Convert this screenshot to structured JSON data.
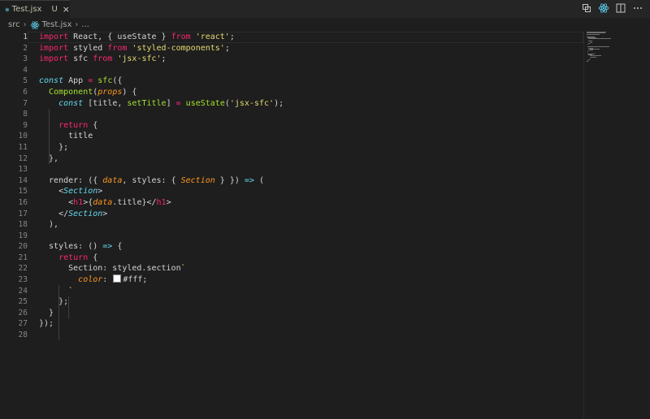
{
  "tab": {
    "file_name": "Test.jsx",
    "status": "U",
    "close": "×"
  },
  "actions": [
    "open-changes-icon",
    "react-preview-icon",
    "split-editor-icon",
    "more-actions-icon"
  ],
  "breadcrumb": {
    "folder": "src",
    "file": "Test.jsx",
    "more": "..."
  },
  "editor": {
    "active_line": 1,
    "line_numbers": [
      "1",
      "2",
      "3",
      "4",
      "5",
      "6",
      "7",
      "8",
      "9",
      "10",
      "11",
      "12",
      "13",
      "14",
      "15",
      "16",
      "17",
      "18",
      "19",
      "20",
      "21",
      "22",
      "23",
      "24",
      "25",
      "26",
      "27",
      "28"
    ],
    "lines": [
      "import React, { useState } from 'react';",
      "import styled from 'styled-components';",
      "import sfc from 'jsx-sfc';",
      "",
      "const App = sfc({",
      "  Component(props) {",
      "    const [title, setTitle] = useState('jsx-sfc');",
      "",
      "    return {",
      "      title",
      "    };",
      "  },",
      "",
      "  render: ({ data, styles: { Section } }) => (",
      "    <Section>",
      "      <h1>{data.title}</h1>",
      "    </Section>",
      "  ),",
      "",
      "  styles: () => {",
      "    return {",
      "      Section: styled.section`",
      "        color: #fff;",
      "      `",
      "    };",
      "  }",
      "});",
      ""
    ]
  },
  "colors": {
    "background": "#1e1e1e",
    "keyword": "#f92672",
    "storage": "#66d9ef",
    "string": "#e6db74",
    "function": "#a6e22e",
    "parameter": "#fd971f",
    "color_swatch": "#ffffff"
  }
}
